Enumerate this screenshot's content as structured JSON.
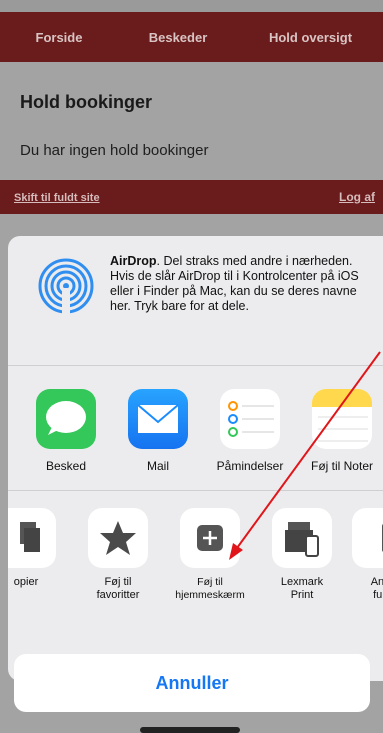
{
  "site": {
    "nav": [
      "Forside",
      "Beskeder",
      "Hold oversigt"
    ],
    "title": "Hold bookinger",
    "text": "Du har ingen hold bookinger",
    "footer_left": "Skift til fuldt site",
    "footer_right": "Log af"
  },
  "share_sheet": {
    "airdrop": {
      "title": "AirDrop",
      "text": ". Del straks med andre i nærheden. Hvis de slår AirDrop til i Kontrolcenter på iOS eller i Finder på Mac, kan du se deres navne her. Tryk bare for at dele."
    },
    "apps": [
      {
        "label": "Besked",
        "icon": "messages-icon",
        "color": "#34c759"
      },
      {
        "label": "Mail",
        "icon": "mail-icon",
        "color": "#1a8cff"
      },
      {
        "label": "Påmindelser",
        "icon": "reminders-icon",
        "color": "#ffffff"
      },
      {
        "label": "Føj til Noter",
        "icon": "notes-icon",
        "color": "#ffd84d"
      }
    ],
    "actions": [
      {
        "label": "opier",
        "icon": "copy-icon"
      },
      {
        "label": "Føj til favoritter",
        "line1": "Føj til",
        "line2": "favoritter",
        "icon": "star-icon"
      },
      {
        "label": "Føj til hjemmeskærm",
        "line1": "Føj til",
        "line2": "hjemmeskærm",
        "icon": "add-to-home-icon"
      },
      {
        "label": "Lexmark Print",
        "line1": "Lexmark",
        "line2": "Print",
        "icon": "printer-icon"
      },
      {
        "label": "Anm fuld",
        "line1": "Anm",
        "line2": "fuld",
        "icon": "partial-icon"
      }
    ],
    "cancel_label": "Annuller"
  },
  "colors": {
    "brand": "#6a1b1b",
    "cancel_text": "#1577f3",
    "arrow": "#e0161b"
  }
}
